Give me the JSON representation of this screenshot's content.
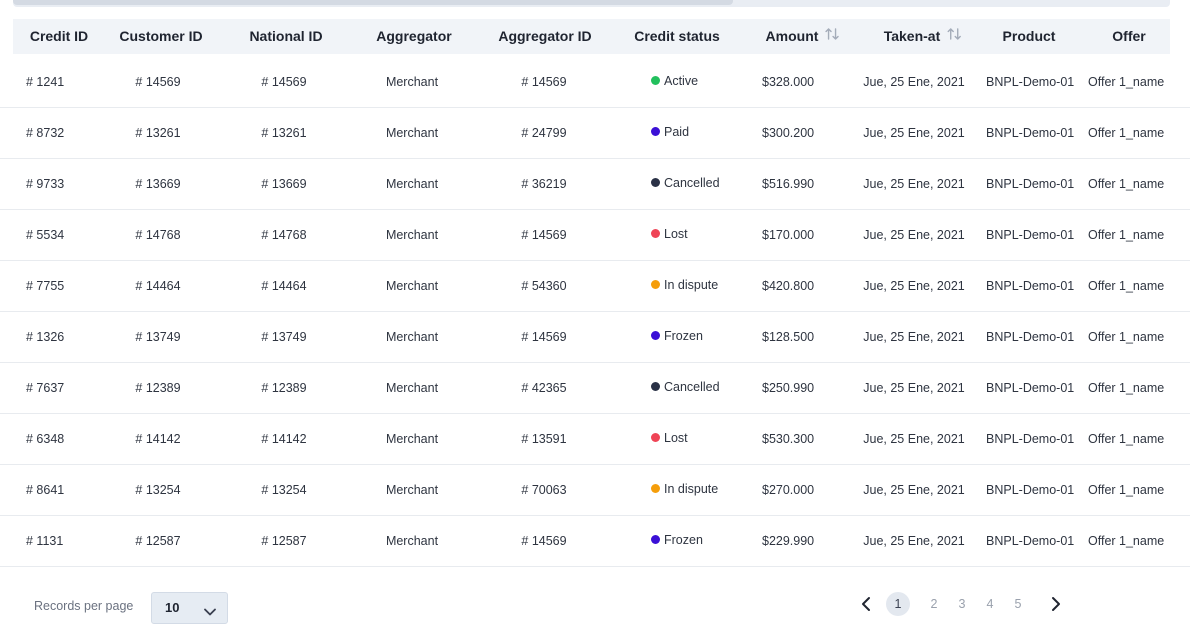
{
  "columns": [
    {
      "key": "credit_id",
      "label": "Credit ID",
      "sortable": false
    },
    {
      "key": "customer_id",
      "label": "Customer  ID",
      "sortable": false
    },
    {
      "key": "national_id",
      "label": "National  ID",
      "sortable": false
    },
    {
      "key": "aggregator",
      "label": "Aggregator",
      "sortable": false
    },
    {
      "key": "aggregator_id",
      "label": "Aggregator ID",
      "sortable": false
    },
    {
      "key": "credit_status",
      "label": "Credit status",
      "sortable": false
    },
    {
      "key": "amount",
      "label": "Amount",
      "sortable": true
    },
    {
      "key": "taken_at",
      "label": "Taken-at",
      "sortable": true
    },
    {
      "key": "product",
      "label": "Product",
      "sortable": false
    },
    {
      "key": "offer",
      "label": "Offer",
      "sortable": false
    }
  ],
  "status_colors": {
    "Active": "#22c05d",
    "Paid": "#3b10d6",
    "Cancelled": "#2a3146",
    "Lost": "#ef4456",
    "In dispute": "#f59e0b",
    "Frozen": "#3b10d6"
  },
  "rows": [
    {
      "credit_id": "# 1241",
      "customer_id": "# 14569",
      "national_id": "# 14569",
      "aggregator": "Merchant",
      "aggregator_id": "# 14569",
      "credit_status": "Active",
      "amount": "$328.000",
      "taken_at": "Jue, 25 Ene, 2021",
      "product": "BNPL-Demo-01",
      "offer": "Offer 1_name"
    },
    {
      "credit_id": "# 8732",
      "customer_id": "# 13261",
      "national_id": "# 13261",
      "aggregator": "Merchant",
      "aggregator_id": "# 24799",
      "credit_status": "Paid",
      "amount": "$300.200",
      "taken_at": "Jue, 25 Ene, 2021",
      "product": "BNPL-Demo-01",
      "offer": "Offer 1_name"
    },
    {
      "credit_id": "# 9733",
      "customer_id": "# 13669",
      "national_id": "# 13669",
      "aggregator": "Merchant",
      "aggregator_id": "# 36219",
      "credit_status": "Cancelled",
      "amount": "$516.990",
      "taken_at": "Jue, 25 Ene, 2021",
      "product": "BNPL-Demo-01",
      "offer": "Offer 1_name"
    },
    {
      "credit_id": "# 5534",
      "customer_id": "# 14768",
      "national_id": "# 14768",
      "aggregator": "Merchant",
      "aggregator_id": "# 14569",
      "credit_status": "Lost",
      "amount": "$170.000",
      "taken_at": "Jue, 25 Ene, 2021",
      "product": "BNPL-Demo-01",
      "offer": "Offer 1_name"
    },
    {
      "credit_id": "# 7755",
      "customer_id": "# 14464",
      "national_id": "# 14464",
      "aggregator": "Merchant",
      "aggregator_id": "# 54360",
      "credit_status": "In dispute",
      "amount": "$420.800",
      "taken_at": "Jue, 25 Ene, 2021",
      "product": "BNPL-Demo-01",
      "offer": "Offer 1_name"
    },
    {
      "credit_id": "# 1326",
      "customer_id": "# 13749",
      "national_id": "# 13749",
      "aggregator": "Merchant",
      "aggregator_id": "# 14569",
      "credit_status": "Frozen",
      "amount": "$128.500",
      "taken_at": "Jue, 25 Ene, 2021",
      "product": "BNPL-Demo-01",
      "offer": "Offer 1_name"
    },
    {
      "credit_id": "# 7637",
      "customer_id": "# 12389",
      "national_id": "# 12389",
      "aggregator": "Merchant",
      "aggregator_id": "# 42365",
      "credit_status": "Cancelled",
      "amount": "$250.990",
      "taken_at": "Jue, 25 Ene, 2021",
      "product": "BNPL-Demo-01",
      "offer": "Offer 1_name"
    },
    {
      "credit_id": "# 6348",
      "customer_id": "# 14142",
      "national_id": "# 14142",
      "aggregator": "Merchant",
      "aggregator_id": "# 13591",
      "credit_status": "Lost",
      "amount": "$530.300",
      "taken_at": "Jue, 25 Ene, 2021",
      "product": "BNPL-Demo-01",
      "offer": "Offer 1_name"
    },
    {
      "credit_id": "# 8641",
      "customer_id": "# 13254",
      "national_id": "# 13254",
      "aggregator": "Merchant",
      "aggregator_id": "# 70063",
      "credit_status": "In dispute",
      "amount": "$270.000",
      "taken_at": "Jue, 25 Ene, 2021",
      "product": "BNPL-Demo-01",
      "offer": "Offer 1_name"
    },
    {
      "credit_id": "# 1131",
      "customer_id": "# 12587",
      "national_id": "# 12587",
      "aggregator": "Merchant",
      "aggregator_id": "# 14569",
      "credit_status": "Frozen",
      "amount": "$229.990",
      "taken_at": "Jue, 25 Ene, 2021",
      "product": "BNPL-Demo-01",
      "offer": "Offer 1_name"
    }
  ],
  "footer": {
    "records_per_page_label": "Records per page",
    "records_per_page_value": "10",
    "pages": [
      "1",
      "2",
      "3",
      "4",
      "5"
    ],
    "current_page": "1"
  },
  "icons": {
    "sort": "sort-arrows-icon",
    "prev": "chevron-left-icon",
    "next": "chevron-right-icon",
    "dropdown": "chevron-down-icon"
  }
}
